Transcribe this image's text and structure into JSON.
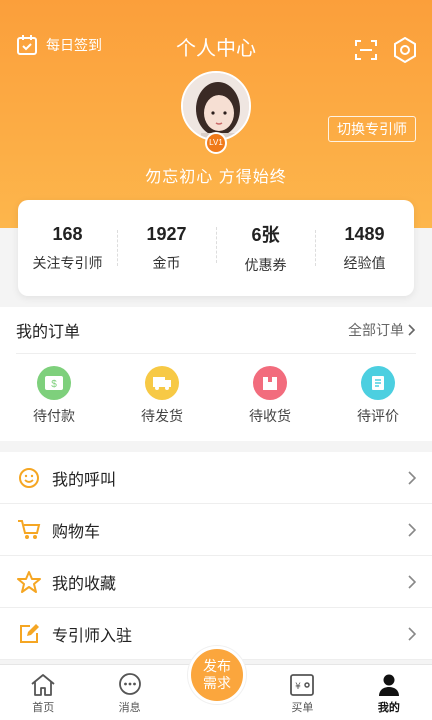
{
  "header": {
    "checkin_label": "每日签到",
    "title": "个人中心",
    "switch_label": "切换专引师",
    "level": "LV1",
    "motto": "勿忘初心 方得始终"
  },
  "stats": [
    {
      "value": "168",
      "label": "关注专引师"
    },
    {
      "value": "1927",
      "label": "金币"
    },
    {
      "value": "6张",
      "label": "优惠券"
    },
    {
      "value": "1489",
      "label": "经验值"
    }
  ],
  "orders": {
    "title": "我的订单",
    "all_label": "全部订单",
    "items": [
      {
        "label": "待付款",
        "icon": "wallet-icon",
        "color": "#7ed07c"
      },
      {
        "label": "待发货",
        "icon": "truck-icon",
        "color": "#f7c945"
      },
      {
        "label": "待收货",
        "icon": "package-icon",
        "color": "#f26c7d"
      },
      {
        "label": "待评价",
        "icon": "review-icon",
        "color": "#4ccfe0"
      }
    ]
  },
  "menu": [
    {
      "label": "我的呼叫",
      "icon": "smile-icon"
    },
    {
      "label": "购物车",
      "icon": "cart-icon"
    },
    {
      "label": "我的收藏",
      "icon": "star-icon"
    },
    {
      "label": "专引师入驻",
      "icon": "edit-icon"
    }
  ],
  "tabs": [
    {
      "label": "首页",
      "icon": "home-icon"
    },
    {
      "label": "消息",
      "icon": "message-icon"
    },
    {
      "label": "",
      "icon": ""
    },
    {
      "label": "买单",
      "icon": "pay-icon"
    },
    {
      "label": "我的",
      "icon": "user-icon"
    }
  ],
  "publish": {
    "label": "发布需求"
  },
  "colors": {
    "accent": "#fba63d",
    "icon": "#f5a623"
  }
}
